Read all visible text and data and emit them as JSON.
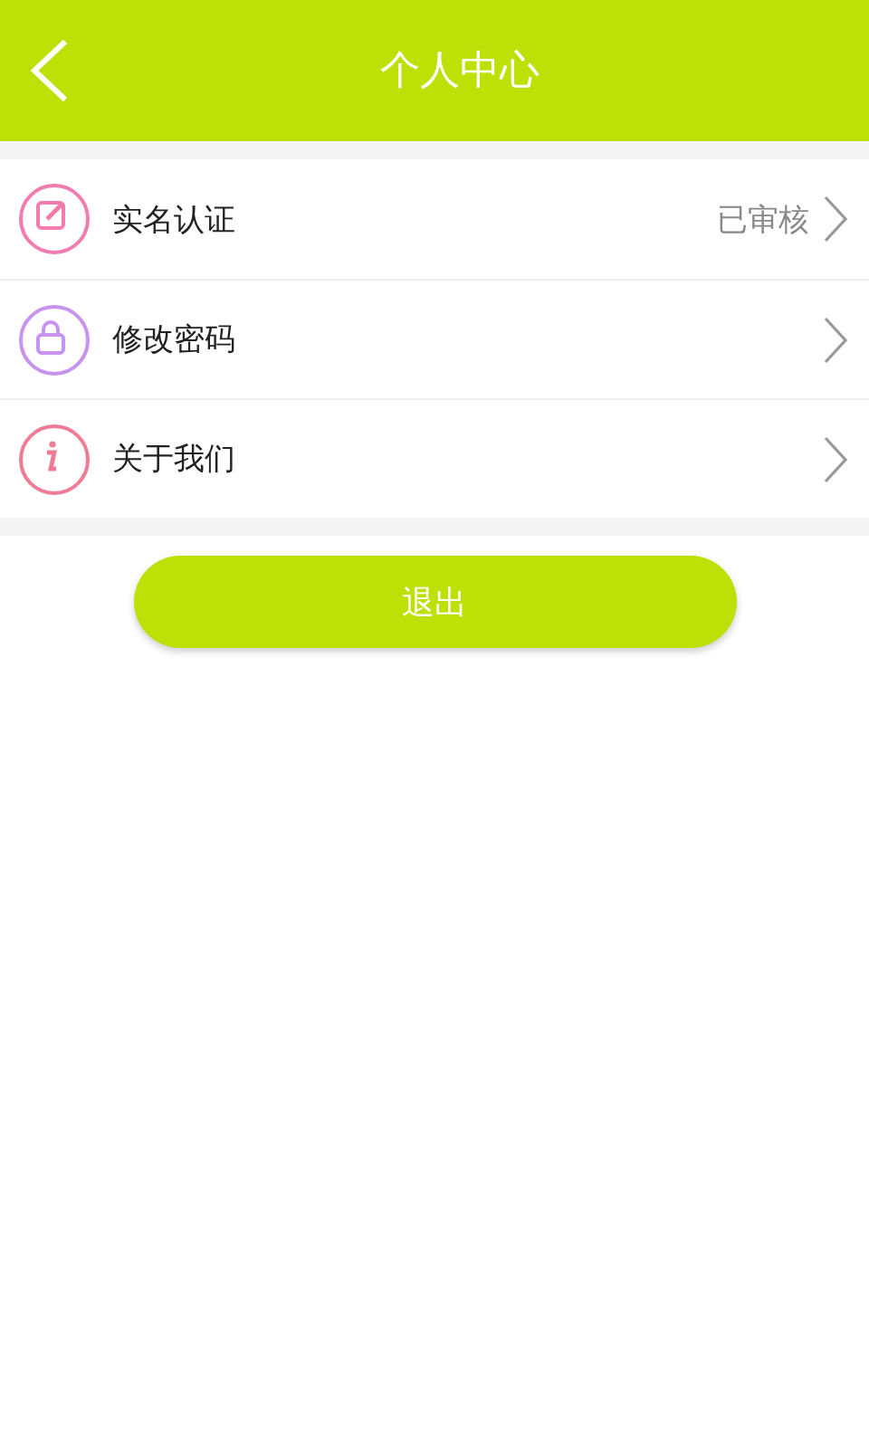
{
  "header": {
    "title": "个人中心"
  },
  "menu": [
    {
      "kind": "edit",
      "label": "实名认证",
      "status": "已审核"
    },
    {
      "kind": "lock",
      "label": "修改密码"
    },
    {
      "kind": "info",
      "label": "关于我们"
    }
  ],
  "logout_button": "退出"
}
